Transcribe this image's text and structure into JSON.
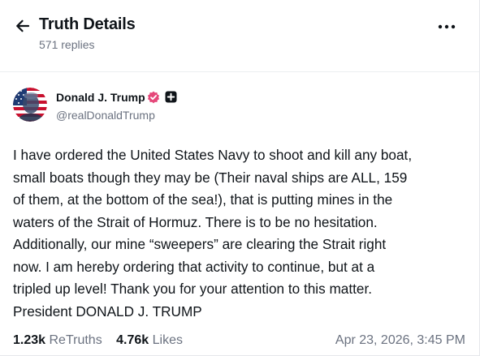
{
  "header": {
    "title": "Truth Details",
    "subtitle": "571 replies"
  },
  "post": {
    "author_name": "Donald J. Trump",
    "handle": "@realDonaldTrump",
    "body_lines": [
      "I have ordered the United States Navy to shoot and kill any boat,",
      "small boats though they may be (Their naval ships are ALL, 159",
      "of them, at the bottom of the sea!), that is putting mines in the",
      "waters of the Strait of Hormuz. There is to be no hesitation.",
      "Additionally, our mine “sweepers” are clearing the Strait right",
      "now. I am hereby ordering that activity to continue, but at a",
      "tripled up level! Thank you for your attention to this matter.",
      "President DONALD J. TRUMP"
    ],
    "retruths_count": "1.23k",
    "retruths_label": "ReTruths",
    "likes_count": "4.76k",
    "likes_label": "Likes",
    "timestamp": "Apr 23, 2026, 3:45 PM"
  },
  "icons": {
    "back": "arrow-left-icon",
    "more": "more-horizontal-icon",
    "verified": "verified-check-icon",
    "plus": "plus-badge-icon"
  },
  "colors": {
    "verified_badge": "#e5487a",
    "muted_text": "#6b7280",
    "primary_text": "#0f1419"
  }
}
